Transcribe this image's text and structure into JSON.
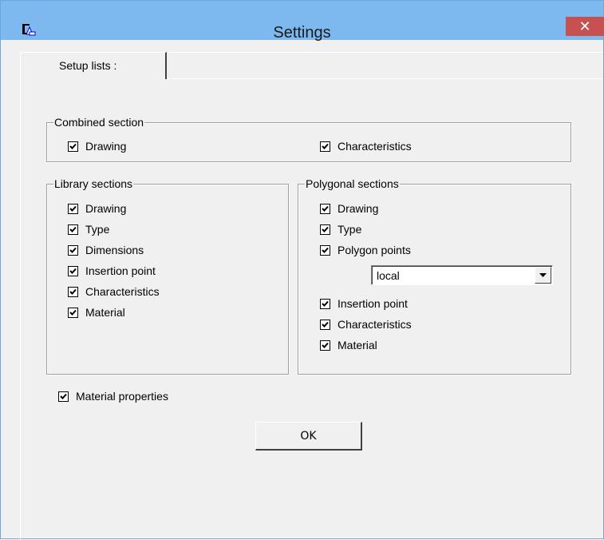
{
  "window": {
    "title": "Settings",
    "close_glyph": "✕",
    "app_icon": "app-icon"
  },
  "tabs": [
    {
      "label": "Setup lists :",
      "active": true
    }
  ],
  "combined_section": {
    "title": "Combined section",
    "items": [
      {
        "label": "Drawing",
        "checked": true
      },
      {
        "label": "Characteristics",
        "checked": true
      }
    ]
  },
  "library_sections": {
    "title": "Library sections",
    "items": [
      {
        "label": "Drawing",
        "checked": true
      },
      {
        "label": "Type",
        "checked": true
      },
      {
        "label": "Dimensions",
        "checked": true
      },
      {
        "label": "Insertion point",
        "checked": true
      },
      {
        "label": "Characteristics",
        "checked": true
      },
      {
        "label": "Material",
        "checked": true
      }
    ]
  },
  "polygonal_sections": {
    "title": "Polygonal sections",
    "items": [
      {
        "label": "Drawing",
        "checked": true
      },
      {
        "label": "Type",
        "checked": true
      },
      {
        "label": "Polygon points",
        "checked": true
      },
      {
        "label": "Insertion point",
        "checked": true
      },
      {
        "label": "Characteristics",
        "checked": true
      },
      {
        "label": "Material",
        "checked": true
      }
    ],
    "coordinate_select": {
      "value": "local"
    }
  },
  "material_properties": {
    "label": "Material properties",
    "checked": true
  },
  "ok_button": {
    "label": "OK"
  },
  "colors": {
    "titlebar": "#7db8ef",
    "close_button": "#c75050",
    "dialog_background": "#f0f0f0"
  }
}
